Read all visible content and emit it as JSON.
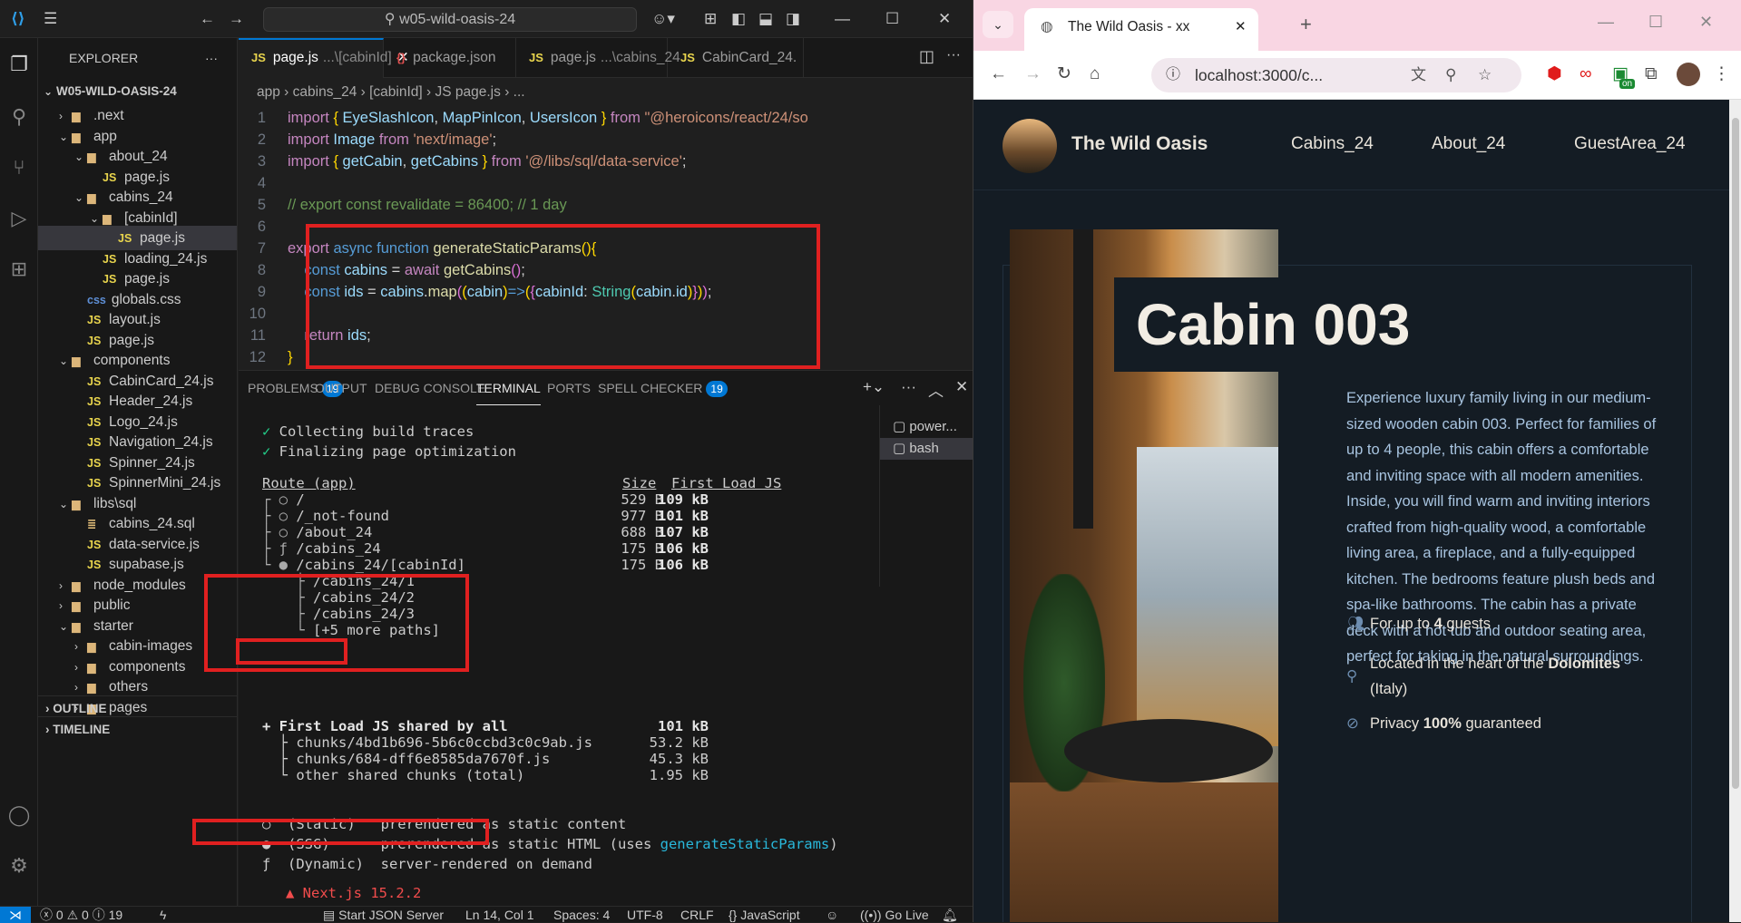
{
  "vscode": {
    "search_text": "w05-wild-oasis-24",
    "explorer_label": "EXPLORER",
    "root_folder": "W05-WILD-OASIS-24",
    "tree": [
      {
        "label": ".next",
        "kind": "folder",
        "depth": 1,
        "open": false
      },
      {
        "label": "app",
        "kind": "folder",
        "depth": 1,
        "open": true
      },
      {
        "label": "about_24",
        "kind": "folder",
        "depth": 2,
        "open": true
      },
      {
        "label": "page.js",
        "kind": "js",
        "depth": 3
      },
      {
        "label": "cabins_24",
        "kind": "folder",
        "depth": 2,
        "open": true
      },
      {
        "label": "[cabinId]",
        "kind": "folder",
        "depth": 3,
        "open": true
      },
      {
        "label": "page.js",
        "kind": "js",
        "depth": 4,
        "selected": true
      },
      {
        "label": "loading_24.js",
        "kind": "js",
        "depth": 3
      },
      {
        "label": "page.js",
        "kind": "js",
        "depth": 3
      },
      {
        "label": "globals.css",
        "kind": "css",
        "depth": 2
      },
      {
        "label": "layout.js",
        "kind": "js",
        "depth": 2
      },
      {
        "label": "page.js",
        "kind": "js",
        "depth": 2
      },
      {
        "label": "components",
        "kind": "folder",
        "depth": 1,
        "open": true
      },
      {
        "label": "CabinCard_24.js",
        "kind": "js",
        "depth": 2
      },
      {
        "label": "Header_24.js",
        "kind": "js",
        "depth": 2
      },
      {
        "label": "Logo_24.js",
        "kind": "js",
        "depth": 2
      },
      {
        "label": "Navigation_24.js",
        "kind": "js",
        "depth": 2
      },
      {
        "label": "Spinner_24.js",
        "kind": "js",
        "depth": 2
      },
      {
        "label": "SpinnerMini_24.js",
        "kind": "js",
        "depth": 2
      },
      {
        "label": "libs\\sql",
        "kind": "folder",
        "depth": 1,
        "open": true
      },
      {
        "label": "cabins_24.sql",
        "kind": "sql",
        "depth": 2
      },
      {
        "label": "data-service.js",
        "kind": "js",
        "depth": 2
      },
      {
        "label": "supabase.js",
        "kind": "js",
        "depth": 2
      },
      {
        "label": "node_modules",
        "kind": "folder",
        "depth": 1,
        "open": false
      },
      {
        "label": "public",
        "kind": "folder",
        "depth": 1,
        "open": false
      },
      {
        "label": "starter",
        "kind": "folder",
        "depth": 1,
        "open": true
      },
      {
        "label": "cabin-images",
        "kind": "folder",
        "depth": 2,
        "open": false
      },
      {
        "label": "components",
        "kind": "folder",
        "depth": 2,
        "open": false
      },
      {
        "label": "others",
        "kind": "folder",
        "depth": 2,
        "open": false
      },
      {
        "label": "pages",
        "kind": "folder",
        "depth": 2,
        "open": false
      }
    ],
    "outline_label": "OUTLINE",
    "timeline_label": "TIMELINE",
    "tabs": [
      {
        "icon": "JS",
        "name": "page.js",
        "hint": "...\\[cabinId]",
        "active": true
      },
      {
        "icon": "{}",
        "name": "package.json",
        "hint": "",
        "active": false
      },
      {
        "icon": "JS",
        "name": "page.js",
        "hint": "...\\cabins_24",
        "active": false
      },
      {
        "icon": "JS",
        "name": "CabinCard_24.",
        "hint": "",
        "active": false
      }
    ],
    "breadcrumb": [
      "app",
      "cabins_24",
      "[cabinId]",
      "JS page.js",
      "..."
    ],
    "panel_tabs": [
      {
        "label": "PROBLEMS",
        "badge": "19"
      },
      {
        "label": "OUTPUT",
        "badge": ""
      },
      {
        "label": "DEBUG CONSOLE",
        "badge": ""
      },
      {
        "label": "TERMINAL",
        "badge": "",
        "active": true
      },
      {
        "label": "PORTS",
        "badge": ""
      },
      {
        "label": "SPELL CHECKER",
        "badge": "19"
      }
    ],
    "terminals": [
      "power...",
      "bash"
    ],
    "terminal": {
      "trace1": "Collecting build traces",
      "trace2": "Finalizing page optimization",
      "col_route": "Route (app)",
      "col_size": "Size",
      "col_first": "First Load JS",
      "routes": [
        {
          "prefix": "┌ ○ ",
          "path": "/",
          "size": "529 B",
          "first": "109 kB"
        },
        {
          "prefix": "├ ○ ",
          "path": "/_not-found",
          "size": "977 B",
          "first": "101 kB"
        },
        {
          "prefix": "├ ○ ",
          "path": "/about_24",
          "size": "688 B",
          "first": "107 kB"
        },
        {
          "prefix": "├ ƒ ",
          "path": "/cabins_24",
          "size": "175 B",
          "first": "106 kB"
        },
        {
          "prefix": "└ ● ",
          "path": "/cabins_24/[cabinId]",
          "size": "175 B",
          "first": "106 kB"
        },
        {
          "prefix": "    ├ ",
          "path": "/cabins_24/1",
          "size": "",
          "first": ""
        },
        {
          "prefix": "    ├ ",
          "path": "/cabins_24/2",
          "size": "",
          "first": ""
        },
        {
          "prefix": "    ├ ",
          "path": "/cabins_24/3",
          "size": "",
          "first": ""
        },
        {
          "prefix": "    └ ",
          "path": "[+5 more paths]",
          "size": "",
          "first": ""
        }
      ],
      "shared_label": "+ First Load JS shared by all",
      "shared_total": "101 kB",
      "chunks": [
        {
          "name": "  ├ chunks/4bd1b696-5b6c0ccbd3c0c9ab.js",
          "size": "53.2 kB"
        },
        {
          "name": "  ├ chunks/684-dff6e8585da7670f.js",
          "size": "45.3 kB"
        },
        {
          "name": "  └ other shared chunks (total)",
          "size": "1.95 kB"
        }
      ],
      "legend_static": "○  (Static)   prerendered as static content",
      "legend_ssg_a": "●  (SSG)      prerendered as static HTML",
      "legend_ssg_b": " (uses ",
      "legend_ssg_fn": "generateStaticParams",
      "legend_ssg_c": ")",
      "legend_dynamic": "ƒ  (Dynamic)  server-rendered on demand",
      "next_version": "▲ Next.js 15.2.2"
    },
    "status": {
      "errors": "0",
      "warnings": "0",
      "info": "19",
      "json_server": "Start JSON Server",
      "position": "Ln 14, Col 1",
      "spaces": "Spaces: 4",
      "encoding": "UTF-8",
      "eol": "CRLF",
      "language": "JavaScript",
      "golive": "Go Live"
    }
  },
  "browser": {
    "tab_title": "The Wild Oasis - xx",
    "url": "localhost:3000/c...",
    "extension_badge": "on",
    "brand": "The Wild Oasis",
    "nav": [
      "Cabins_24",
      "About_24",
      "GuestArea_24"
    ],
    "cabin_title": "Cabin 003",
    "description": "Experience luxury family living in our medium-sized wooden cabin 003. Perfect for families of up to 4 people, this cabin offers a comfortable and inviting space with all modern amenities. Inside, you will find warm and inviting interiors crafted from high-quality wood, a comfortable living area, a fireplace, and a fully-equipped kitchen. The bedrooms feature plush beds and spa-like bathrooms. The cabin has a private deck with a hot tub and outdoor seating area, perfect for taking in the natural surroundings.",
    "feature_guests_a": "For up to ",
    "feature_guests_b": "4",
    "feature_guests_c": " guests",
    "feature_loc_a": "Located in the heart of the ",
    "feature_loc_b": "Dolomites",
    "feature_loc_c": "(Italy)",
    "feature_priv_a": "Privacy ",
    "feature_priv_b": "100%",
    "feature_priv_c": " guaranteed"
  }
}
